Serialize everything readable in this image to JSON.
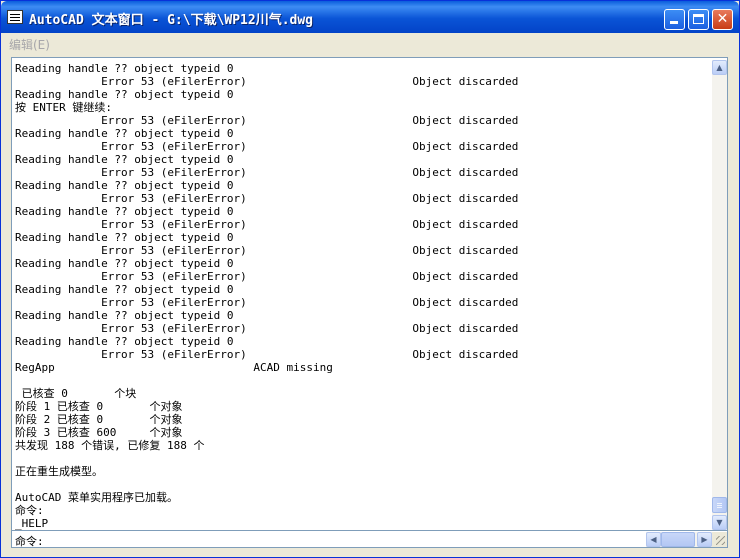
{
  "window": {
    "title": "AutoCAD 文本窗口 - G:\\下载\\WP12川气.dwg",
    "minimize_glyph": "_",
    "maximize_glyph": "□",
    "close_glyph": "✕"
  },
  "menu": {
    "items": [
      {
        "label": "编辑(E)"
      }
    ]
  },
  "log": {
    "lines": [
      "Reading handle ?? object typeid 0",
      "             Error 53 (eFilerError)                         Object discarded",
      "Reading handle ?? object typeid 0",
      "按 ENTER 键继续:",
      "             Error 53 (eFilerError)                         Object discarded",
      "Reading handle ?? object typeid 0",
      "             Error 53 (eFilerError)                         Object discarded",
      "Reading handle ?? object typeid 0",
      "             Error 53 (eFilerError)                         Object discarded",
      "Reading handle ?? object typeid 0",
      "             Error 53 (eFilerError)                         Object discarded",
      "Reading handle ?? object typeid 0",
      "             Error 53 (eFilerError)                         Object discarded",
      "Reading handle ?? object typeid 0",
      "             Error 53 (eFilerError)                         Object discarded",
      "Reading handle ?? object typeid 0",
      "             Error 53 (eFilerError)                         Object discarded",
      "Reading handle ?? object typeid 0",
      "             Error 53 (eFilerError)                         Object discarded",
      "Reading handle ?? object typeid 0",
      "             Error 53 (eFilerError)                         Object discarded",
      "Reading handle ?? object typeid 0",
      "             Error 53 (eFilerError)                         Object discarded",
      "RegApp                              ACAD missing",
      "",
      " 已核查 0       个块",
      "阶段 1 已核查 0       个对象",
      "阶段 2 已核查 0       个对象",
      "阶段 3 已核查 600     个对象",
      "共发现 188 个错误, 已修复 188 个",
      "",
      "正在重生成模型。",
      "",
      "AutoCAD 菜单实用程序已加载。",
      "命令:",
      "_HELP"
    ]
  },
  "command": {
    "label": "命令:",
    "value": ""
  },
  "scrollbars": {
    "up_glyph": "▲",
    "down_glyph": "▼",
    "left_glyph": "◀",
    "right_glyph": "▶",
    "vertical_position": 1.0
  }
}
